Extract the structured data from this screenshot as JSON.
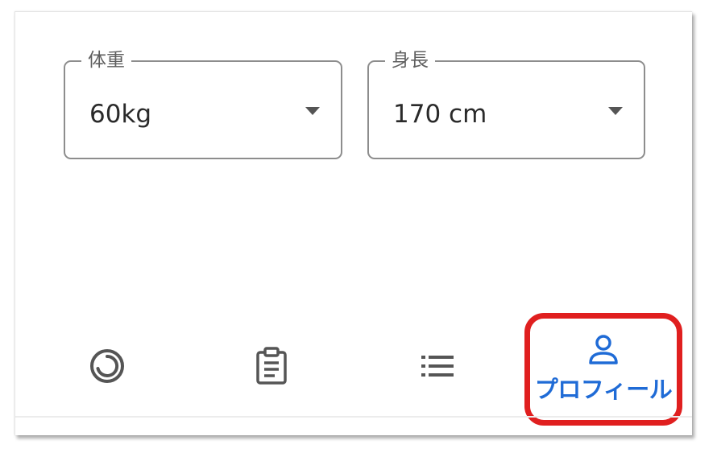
{
  "form": {
    "weight": {
      "label": "体重",
      "value": "60kg"
    },
    "height": {
      "label": "身長",
      "value": "170 cm"
    }
  },
  "bottom_nav": {
    "items": [
      {
        "icon": "circle-progress-icon"
      },
      {
        "icon": "clipboard-icon"
      },
      {
        "icon": "list-icon"
      },
      {
        "icon": "person-icon",
        "label": "プロフィール",
        "selected": true
      }
    ]
  },
  "colors": {
    "accent": "#1f6bd6",
    "highlight_border": "#e01f1f",
    "icon_inactive": "#555555",
    "field_border": "#8d8d8d"
  }
}
